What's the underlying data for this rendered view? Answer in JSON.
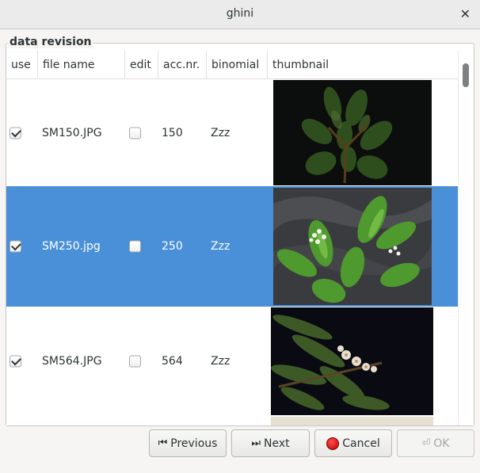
{
  "window": {
    "title": "ghini"
  },
  "frame": {
    "label": "data revision"
  },
  "columns": [
    "use",
    "file name",
    "edit",
    "acc.nr.",
    "binomial",
    "thumbnail"
  ],
  "rows": [
    {
      "use": true,
      "file_name": "SM150.JPG",
      "edit": false,
      "acc_nr": "150",
      "binomial": "Zzz",
      "selected": false
    },
    {
      "use": true,
      "file_name": "SM250.jpg",
      "edit": false,
      "acc_nr": "250",
      "binomial": "Zzz",
      "selected": true
    },
    {
      "use": true,
      "file_name": "SM564.JPG",
      "edit": false,
      "acc_nr": "564",
      "binomial": "Zzz",
      "selected": false
    }
  ],
  "buttons": {
    "previous": "Previous",
    "next": "Next",
    "cancel": "Cancel",
    "ok": "OK"
  },
  "colors": {
    "selection": "#4a90d9"
  }
}
